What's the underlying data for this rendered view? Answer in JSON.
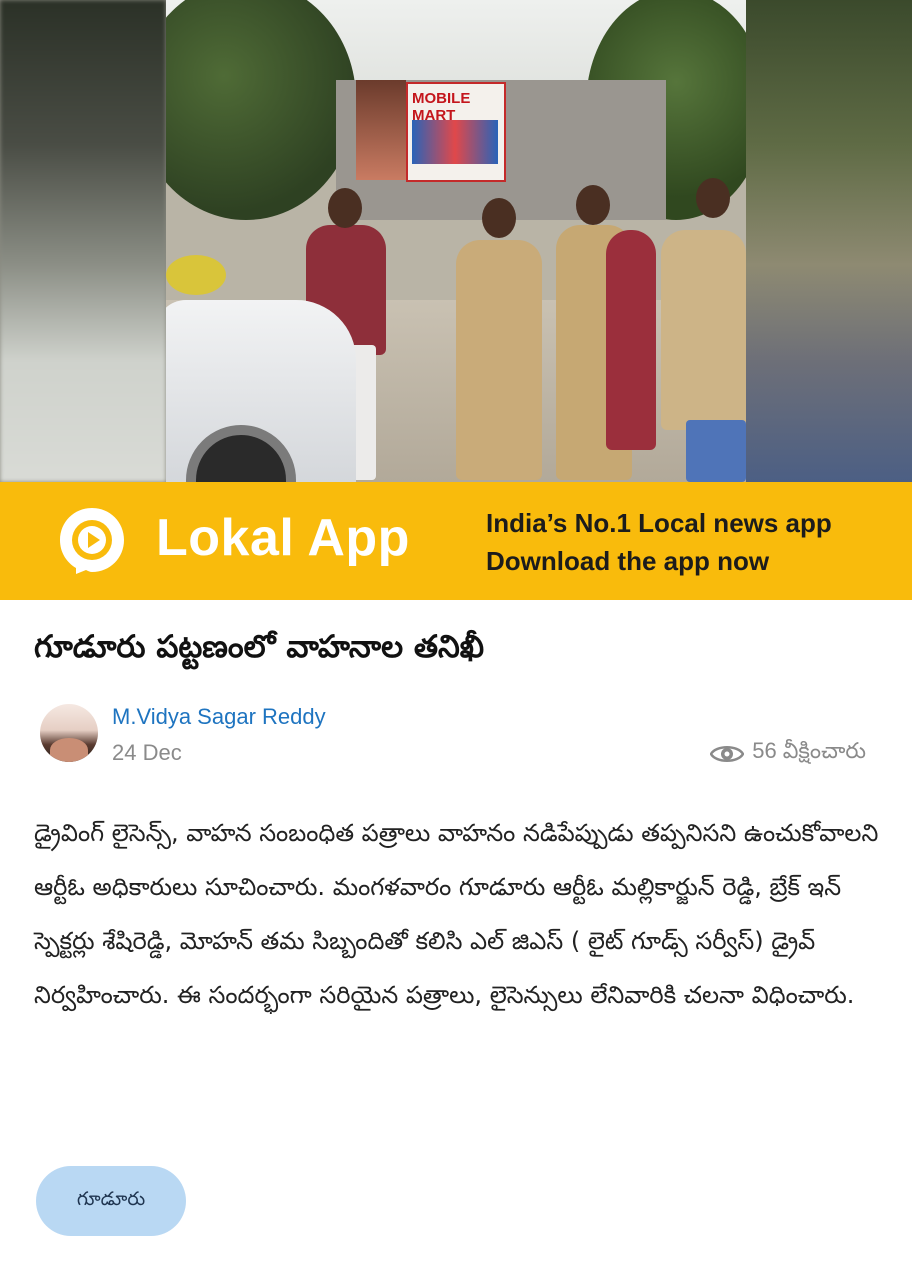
{
  "banner": {
    "brand": "Lokal App",
    "tagline_line1": "India’s No.1 Local news app",
    "tagline_line2": "Download the app now",
    "color": "#f9bb0c"
  },
  "photo": {
    "shop_sign": "MOBILE MART"
  },
  "article": {
    "title": "గూడూరు పట్టణంలో వాహనాల తనిఖీ",
    "author": "M.Vidya Sagar Reddy",
    "date": "24 Dec",
    "views": "56 వీక్షించారు",
    "body": "డ్రైవింగ్ లైసెన్స్, వాహన సంబంధిత పత్రాలు వాహనం నడిపేప్పుడు తప్పనిసని ఉంచుకోవాలని ఆర్టీఓ అధికారులు సూచించారు. మంగళవారం గూడూరు ఆర్టీఓ మల్లికార్జున్ రెడ్డి, బ్రేక్ ఇన్ స్పెక్టర్లు శేషిరెడ్డి, మోహన్ తమ సిబ్బందితో కలిసి ఎల్ జిఎస్ ( లైట్ గూడ్స్ సర్వీస్) డ్రైవ్ నిర్వహించారు. ఈ సందర్భంగా సరియైన పత్రాలు, లైసెన్సులు లేనివారికి చలనా విధించారు.",
    "tag": "గూడూరు"
  },
  "colors": {
    "author_link": "#1e74c0",
    "tag_chip": "#b9d8f3"
  },
  "icons": {
    "logo": "lokal-logo-icon",
    "views": "eye-icon"
  }
}
